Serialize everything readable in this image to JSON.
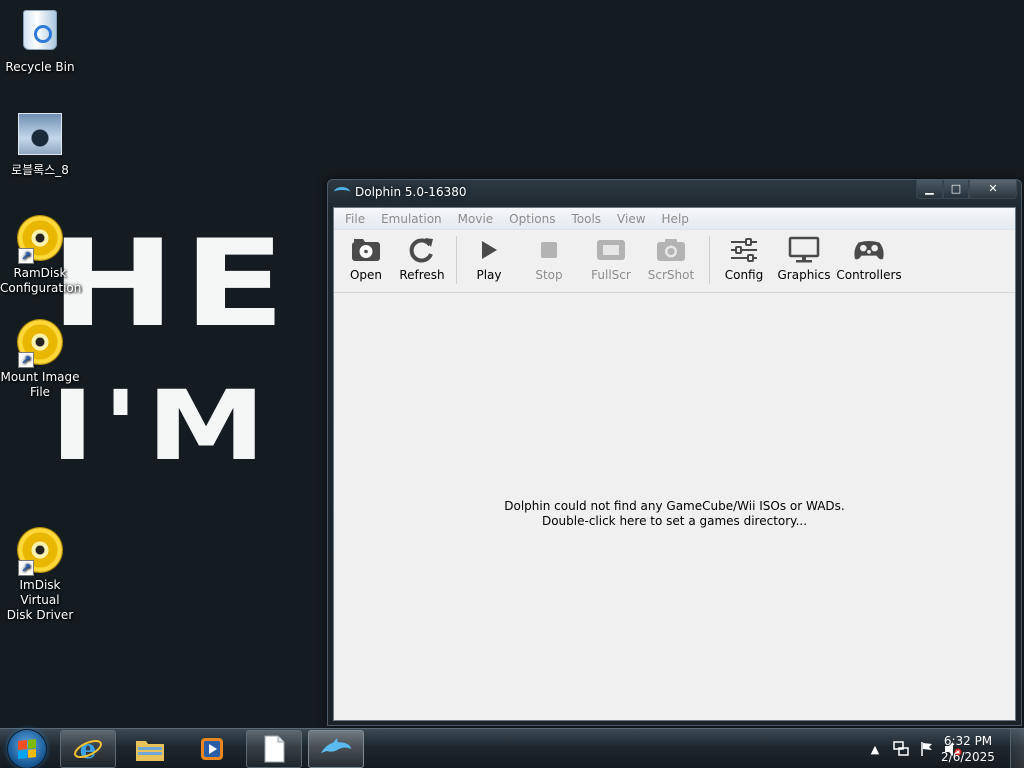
{
  "wallpaper": {
    "line1": "HE",
    "line2": "I'M "
  },
  "desktop": {
    "recycle_bin": "Recycle Bin",
    "roblox": "로블록스_8",
    "ramdisk": {
      "line1": "RamDisk",
      "line2": "Configuration"
    },
    "mount": {
      "line1": "Mount Image",
      "line2": "File"
    },
    "imdisk": {
      "line1": "ImDisk Virtual",
      "line2": "Disk Driver"
    }
  },
  "window": {
    "title": "Dolphin 5.0-16380",
    "controls": {
      "minimize": "▁",
      "maximize": "□",
      "close": "✕"
    },
    "menu": [
      "File",
      "Emulation",
      "Movie",
      "Options",
      "Tools",
      "View",
      "Help"
    ],
    "toolbar": {
      "open": "Open",
      "refresh": "Refresh",
      "play": "Play",
      "stop": "Stop",
      "fullscr": "FullScr",
      "scrshot": "ScrShot",
      "config": "Config",
      "graphics": "Graphics",
      "controllers": "Controllers"
    },
    "empty_message": {
      "line1": "Dolphin could not find any GameCube/Wii ISOs or WADs.",
      "line2": "Double-click here to set a games directory..."
    }
  },
  "taskbar": {
    "tray": {
      "arrow": "▲"
    },
    "clock": {
      "time": "6:32 PM",
      "date": "2/6/2025"
    }
  },
  "colors": {
    "desktop_bg": "#151c21",
    "accent": "#4fb0e8",
    "disabled_text": "#8d8d8d"
  }
}
